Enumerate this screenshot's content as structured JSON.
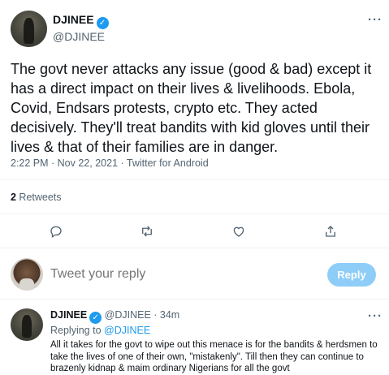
{
  "tweet": {
    "author_name": "DJINEE",
    "author_handle": "@DJINEE",
    "more_label": "···",
    "text": "The govt never attacks any issue (good & bad) except it has a direct impact on their lives & livelihoods. Ebola, Covid, Endsars protests, crypto etc. They acted decisively. They'll treat bandits with kid gloves until their lives & that of their families are in danger.",
    "meta": "2:22 PM · Nov 22, 2021 · Twitter for Android",
    "retweet_count": "2",
    "retweet_label": " Retweets"
  },
  "actions": {
    "icons": [
      "reply-icon",
      "retweet-icon",
      "like-icon",
      "share-icon"
    ]
  },
  "compose": {
    "placeholder": "Tweet your reply",
    "button_label": "Reply"
  },
  "reply": {
    "author_name": "DJINEE",
    "author_handle": "@DJINEE",
    "time": " · 34m",
    "more_label": "···",
    "replying_prefix": "Replying to ",
    "replying_to": "@DJINEE",
    "text": "All it takes for the govt to wipe out this menace is for the bandits & herdsmen to take the lives of one of their own, \"mistakenly\". Till then they can continue to brazenly kidnap & maim ordinary Nigerians for all the govt"
  },
  "colors": {
    "accent": "#1d9bf0",
    "reply_button": "#8ecdf7",
    "secondary_text": "#536471"
  }
}
